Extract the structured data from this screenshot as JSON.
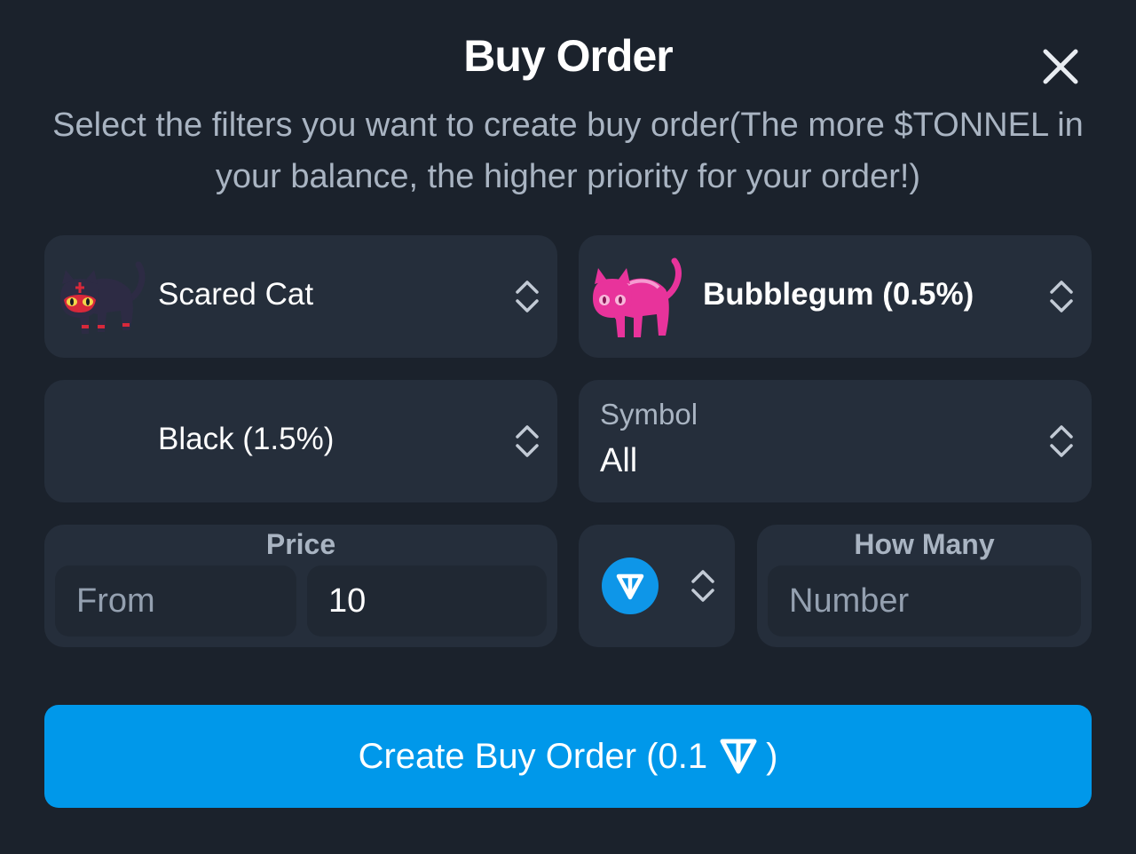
{
  "modal": {
    "title": "Buy Order",
    "subtitle": "Select the filters you want to create buy order(The more $TONNEL in your balance, the higher priority for your order!)"
  },
  "filters": {
    "model": {
      "label": "Scared Cat",
      "icon": "black-cat-icon"
    },
    "backdrop": {
      "label": "Bubblegum (0.5%)",
      "icon": "pink-cat-icon"
    },
    "color": {
      "label": "Black (1.5%)"
    },
    "symbol": {
      "label": "Symbol",
      "value": "All"
    }
  },
  "price": {
    "label": "Price",
    "from_placeholder": "From",
    "to_value": "10"
  },
  "currency": {
    "icon": "ton-coin-icon"
  },
  "quantity": {
    "label": "How Many",
    "placeholder": "Number"
  },
  "cta": {
    "prefix": "Create Buy Order (0.1",
    "suffix": ")",
    "icon": "ton-icon"
  },
  "colors": {
    "background": "#1b222c",
    "card": "#252e3b",
    "accent": "#0098ea",
    "muted_text": "#a9b4c2"
  }
}
